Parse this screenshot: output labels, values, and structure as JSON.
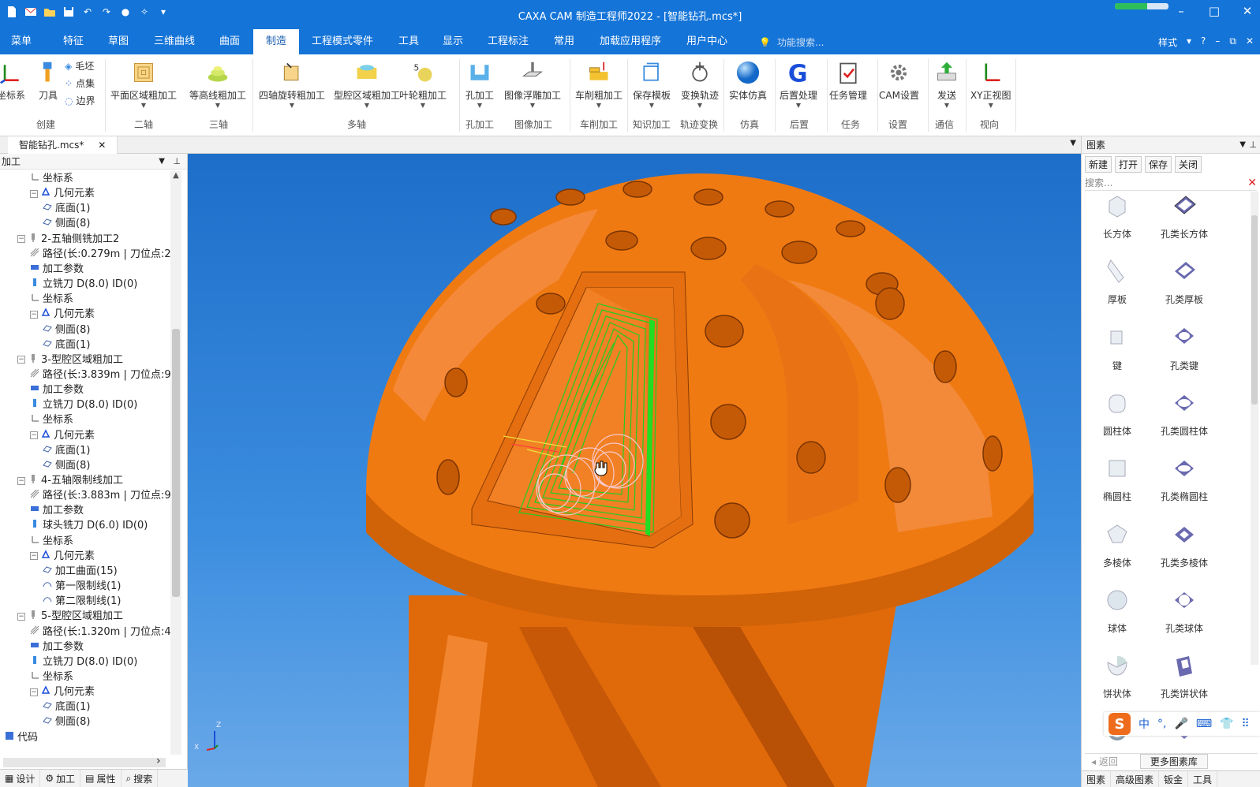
{
  "window": {
    "title": "CAXA CAM 制造工程师2022 - [智能钻孔.mcs*]",
    "progress": 0.6,
    "controls": [
      "–",
      "□",
      "✕"
    ]
  },
  "menu": {
    "tabs": [
      "菜单",
      "特征",
      "草图",
      "三维曲线",
      "曲面",
      "制造",
      "工程模式零件",
      "工具",
      "显示",
      "工程标注",
      "常用",
      "加载应用程序",
      "用户中心"
    ],
    "active": "制造",
    "search_placeholder": "功能搜索...",
    "style_label": "样式",
    "help": "?",
    "mini_controls": [
      "–",
      "⧉",
      "✕"
    ]
  },
  "ribbon": {
    "buttons": [
      "坐标系",
      "刀具",
      "平面区域粗加工",
      "等高线粗加工",
      "四轴旋转粗加工",
      "型腔区域粗加工",
      "叶轮粗加工",
      "孔加工",
      "图像浮雕加工",
      "车削粗加工",
      "保存模板",
      "变换轨迹",
      "实体仿真",
      "后置处理",
      "任务管理",
      "CAM设置",
      "发送",
      "XY正视图"
    ],
    "small": [
      "毛坯",
      "点集",
      "边界"
    ],
    "groups": [
      "创建",
      "二轴",
      "三轴",
      "多轴",
      "孔加工",
      "图像加工",
      "车削加工",
      "知识加工",
      "轨迹变换",
      "仿真",
      "后置",
      "任务",
      "设置",
      "通信",
      "视向"
    ]
  },
  "doc_tab": {
    "label": "智能钻孔.mcs*",
    "close": "✕"
  },
  "left_panel": {
    "header": "加工",
    "tree": [
      "坐标系",
      "几何元素",
      "底面(1)",
      "侧面(8)",
      "2-五轴侧铣加工2",
      "路径(长:0.279m | 刀位点:2",
      "加工参数",
      "立铣刀 D(8.0) ID(0)",
      "坐标系",
      "几何元素",
      "侧面(8)",
      "底面(1)",
      "3-型腔区域粗加工",
      "路径(长:3.839m | 刀位点:9",
      "加工参数",
      "立铣刀 D(8.0) ID(0)",
      "坐标系",
      "几何元素",
      "底面(1)",
      "侧面(8)",
      "4-五轴限制线加工",
      "路径(长:3.883m | 刀位点:9",
      "加工参数",
      "球头铣刀 D(6.0) ID(0)",
      "坐标系",
      "几何元素",
      "加工曲面(15)",
      "第一限制线(1)",
      "第二限制线(1)",
      "5-型腔区域粗加工",
      "路径(长:1.320m | 刀位点:4",
      "加工参数",
      "立铣刀 D(8.0) ID(0)",
      "坐标系",
      "几何元素",
      "底面(1)",
      "侧面(8)",
      "代码"
    ],
    "bottom_tabs": [
      "设计",
      "加工",
      "属性",
      "搜索"
    ]
  },
  "viewport": {
    "axis": {
      "z": "Z",
      "x": "X"
    }
  },
  "right_panel": {
    "header": "图素",
    "tools": [
      "新建",
      "打开",
      "保存",
      "关闭"
    ],
    "search_label": "搜索...",
    "items": [
      "长方体",
      "孔类长方体",
      "厚板",
      "孔类厚板",
      "键",
      "孔类键",
      "圆柱体",
      "孔类圆柱体",
      "椭圆柱",
      "孔类椭圆柱",
      "多棱体",
      "孔类多棱体",
      "球体",
      "孔类球体",
      "饼状体",
      "孔类饼状体"
    ],
    "back": "返回",
    "more": "更多图素库",
    "tabs": [
      "图素",
      "高级图素",
      "钣金",
      "工具"
    ]
  },
  "ime": {
    "logo": "S",
    "items": [
      "中",
      "°,",
      "🎤",
      "⌨",
      "👕",
      "⠿"
    ]
  },
  "colors": {
    "titlebar": "#1474d8",
    "part": "#f07a12",
    "toolpath_green": "#22cc22",
    "toolpath_pink": "#f4b7b7"
  }
}
